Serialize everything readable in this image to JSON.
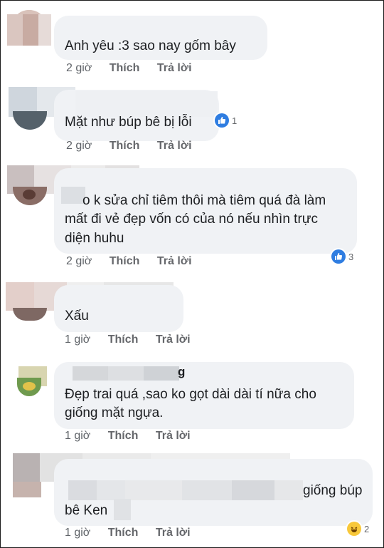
{
  "comments": [
    {
      "text_lines": [
        "Anh yêu :3 sao nay gốm bây"
      ],
      "time": "2 giờ",
      "like": "Thích",
      "reply": "Trả lời"
    },
    {
      "text_lines": [
        "Mặt như búp bê bị lỗi"
      ],
      "time": "2 giờ",
      "like": "Thích",
      "reply": "Trả lời",
      "reactions": {
        "icon": "like-icon",
        "count": "1"
      }
    },
    {
      "text_lines": [
        "o k sửa chỉ tiêm thôi mà tiêm quá đà làm",
        "mất đi vẻ đẹp vốn có của nó nếu nhìn trực",
        "diện huhu"
      ],
      "time": "2 giờ",
      "like": "Thích",
      "reply": "Trả lời",
      "reactions": {
        "icon": "like-icon",
        "count": "3"
      }
    },
    {
      "text_lines": [
        "Xấu"
      ],
      "time": "1 giờ",
      "like": "Thích",
      "reply": "Trả lời"
    },
    {
      "name_tail": "g",
      "text_lines": [
        "Đẹp trai quá ,sao ko gọt dài dài tí nữa cho",
        "giống mặt ngựa."
      ],
      "time": "1 giờ",
      "like": "Thích",
      "reply": "Trả lời"
    },
    {
      "text_lines": [
        "giống búp",
        "bê Ken"
      ],
      "time": "1 giờ",
      "like": "Thích",
      "reply": "Trả lời",
      "reactions": {
        "icon": "haha-icon",
        "count": "2"
      }
    }
  ]
}
